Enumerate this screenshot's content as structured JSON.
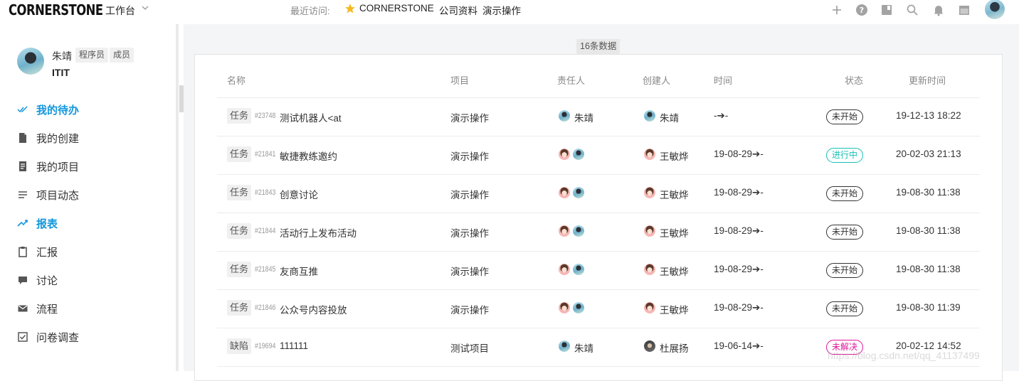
{
  "topbar": {
    "logo": "CORNERSTONE",
    "workspace": "工作台",
    "recent_label": "最近访问:",
    "recent_items": [
      "CORNERSTONE",
      "公司资料",
      "演示操作"
    ],
    "icons": [
      "plus-icon",
      "help-icon",
      "book-icon",
      "search-icon",
      "bell-icon",
      "calendar-icon"
    ]
  },
  "profile": {
    "name": "朱靖",
    "roles": [
      "程序员",
      "成员"
    ],
    "team": "ITIT"
  },
  "sidebar": {
    "items": [
      {
        "label": "我的待办",
        "icon": "check-double-icon",
        "active": true
      },
      {
        "label": "我的创建",
        "icon": "file-icon",
        "active": false
      },
      {
        "label": "我的项目",
        "icon": "document-icon",
        "active": false
      },
      {
        "label": "项目动态",
        "icon": "list-icon",
        "active": false
      },
      {
        "label": "报表",
        "icon": "trend-icon",
        "active": true
      },
      {
        "label": "汇报",
        "icon": "clipboard-icon",
        "active": false
      },
      {
        "label": "讨论",
        "icon": "chat-icon",
        "active": false
      },
      {
        "label": "流程",
        "icon": "mail-icon",
        "active": false
      },
      {
        "label": "问卷调查",
        "icon": "checkbox-icon",
        "active": false
      }
    ]
  },
  "table": {
    "count_label": "16条数据",
    "headers": [
      "名称",
      "项目",
      "责任人",
      "创建人",
      "时间",
      "状态",
      "更新时间"
    ],
    "rows": [
      {
        "type": "任务",
        "id": "#23748",
        "title": "测试机器人<at",
        "project": "演示操作",
        "owners": [
          "zhu"
        ],
        "owner_name": "朱靖",
        "creator_avatar": "zhu",
        "creator": "朱靖",
        "time": "-➔-",
        "status": "未开始",
        "status_kind": "normal",
        "updated": "19-12-13 18:22"
      },
      {
        "type": "任务",
        "id": "#21841",
        "title": "敏捷教练邀约",
        "project": "演示操作",
        "owners": [
          "wang",
          "zhu"
        ],
        "owner_name": "",
        "creator_avatar": "wang",
        "creator": "王敏烨",
        "time": "19-08-29➔-",
        "status": "进行中",
        "status_kind": "progress",
        "updated": "20-02-03 21:13"
      },
      {
        "type": "任务",
        "id": "#21843",
        "title": "创意讨论",
        "project": "演示操作",
        "owners": [
          "wang",
          "zhu"
        ],
        "owner_name": "",
        "creator_avatar": "wang",
        "creator": "王敏烨",
        "time": "19-08-29➔-",
        "status": "未开始",
        "status_kind": "normal",
        "updated": "19-08-30 11:38"
      },
      {
        "type": "任务",
        "id": "#21844",
        "title": "活动行上发布活动",
        "project": "演示操作",
        "owners": [
          "wang",
          "zhu"
        ],
        "owner_name": "",
        "creator_avatar": "wang",
        "creator": "王敏烨",
        "time": "19-08-29➔-",
        "status": "未开始",
        "status_kind": "normal",
        "updated": "19-08-30 11:38"
      },
      {
        "type": "任务",
        "id": "#21845",
        "title": "友商互推",
        "project": "演示操作",
        "owners": [
          "wang",
          "zhu"
        ],
        "owner_name": "",
        "creator_avatar": "wang",
        "creator": "王敏烨",
        "time": "19-08-29➔-",
        "status": "未开始",
        "status_kind": "normal",
        "updated": "19-08-30 11:38"
      },
      {
        "type": "任务",
        "id": "#21846",
        "title": "公众号内容投放",
        "project": "演示操作",
        "owners": [
          "wang",
          "zhu"
        ],
        "owner_name": "",
        "creator_avatar": "wang",
        "creator": "王敏烨",
        "time": "19-08-29➔-",
        "status": "未开始",
        "status_kind": "normal",
        "updated": "19-08-30 11:39"
      },
      {
        "type": "缺陷",
        "id": "#19694",
        "title": "111111",
        "project": "测试项目",
        "owners": [
          "zhu"
        ],
        "owner_name": "朱靖",
        "creator_avatar": "du",
        "creator": "杜展扬",
        "time": "19-06-14➔-",
        "status": "未解决",
        "status_kind": "bug",
        "updated": "20-02-12 14:52"
      }
    ]
  },
  "watermark": "https://blog.csdn.net/qq_41137499",
  "colors": {
    "accent": "#1296db",
    "progress": "#16c2b6",
    "bug": "#e0189a"
  }
}
